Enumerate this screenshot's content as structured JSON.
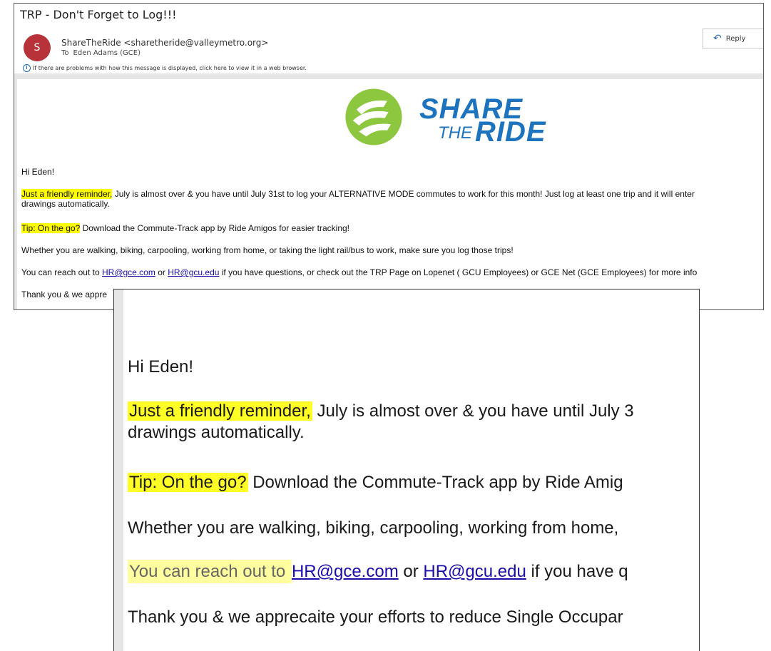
{
  "email": {
    "subject": "TRP - Don't Forget to Log!!!",
    "avatar_initial": "S",
    "sender": "ShareTheRide <sharetheride@valleymetro.org>",
    "to_label": "To",
    "to_name": "Eden Adams (GCE)",
    "info_icon": "info-icon",
    "info_text": "If there are problems with how this message is displayed, click here to view it in a web browser.",
    "reply_label": "Reply",
    "logo": {
      "share": "SHARE",
      "the": "THE",
      "ride": "RIDE",
      "colors": {
        "green": "#8dc63f",
        "blue": "#1e73be"
      }
    },
    "greeting": "Hi Eden!",
    "p1_highlight": "Just a friendly reminder,",
    "p1_rest": " July is almost over & you have until July 31st to log your ALTERNATIVE MODE commutes to work for this month! Just log at least one trip and it will enter",
    "p1_line2": "drawings automatically.",
    "p2_highlight": "Tip: On the go?",
    "p2_rest": " Download the Commute-Track app by Ride Amigos for easier tracking!",
    "p3": "Whether you are walking, biking, carpooling, working from home, or taking the light rail/bus to work, make sure you log those trips!",
    "p4_start": "You can reach out to ",
    "p4_link1": "HR@gce.com",
    "p4_mid": " or ",
    "p4_link2": "HR@gcu.edu",
    "p4_rest": " if you have questions, or check out the TRP Page on Lopenet ( GCU Employees) or GCE Net (GCE Employees) for more info",
    "p5": "Thank you & we appre"
  },
  "zoom": {
    "greeting": "Hi Eden!",
    "p1_highlight": "Just a friendly reminder,",
    "p1_rest": " July is almost over & you have until July 3",
    "p1_line2": "drawings automatically.",
    "p2_highlight": "Tip: On the go?",
    "p2_rest": " Download the Commute-Track app by Ride Amig",
    "p3": "Whether you are walking, biking, carpooling, working from home, ",
    "p4_start": "You can reach out to ",
    "p4_link1": "HR@gce.com",
    "p4_mid": " or ",
    "p4_link2": "HR@gcu.edu",
    "p4_rest": " if you have q",
    "p5": "Thank you & we apprecaite your efforts to reduce Single Occupar"
  },
  "colors": {
    "highlight": "#ffff00",
    "link": "#1a0dab",
    "avatar": "#b8323a"
  }
}
